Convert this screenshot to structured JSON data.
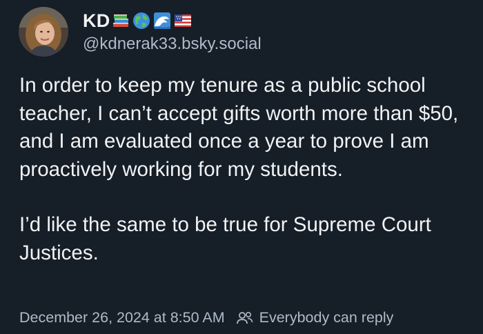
{
  "author": {
    "display_name": "KD",
    "name_emojis": [
      "books-emoji-icon",
      "globe-emoji-icon",
      "wave-emoji-icon",
      "us-flag-emoji-icon"
    ],
    "handle": "@kdnerak33.bsky.social"
  },
  "post": {
    "paragraph_1": "In order to keep my tenure as a public school teacher, I can’t accept gifts worth more than $50, and I am evaluated once a year to prove I am proactively working for my students.",
    "paragraph_2": "I’d like the same to be true for Supreme Court Justices."
  },
  "meta": {
    "timestamp": "December 26, 2024 at 8:50 AM",
    "reply_setting": "Everybody can reply"
  },
  "colors": {
    "background": "#161e27",
    "text": "#f1f3f5",
    "muted": "#aebbc9"
  }
}
